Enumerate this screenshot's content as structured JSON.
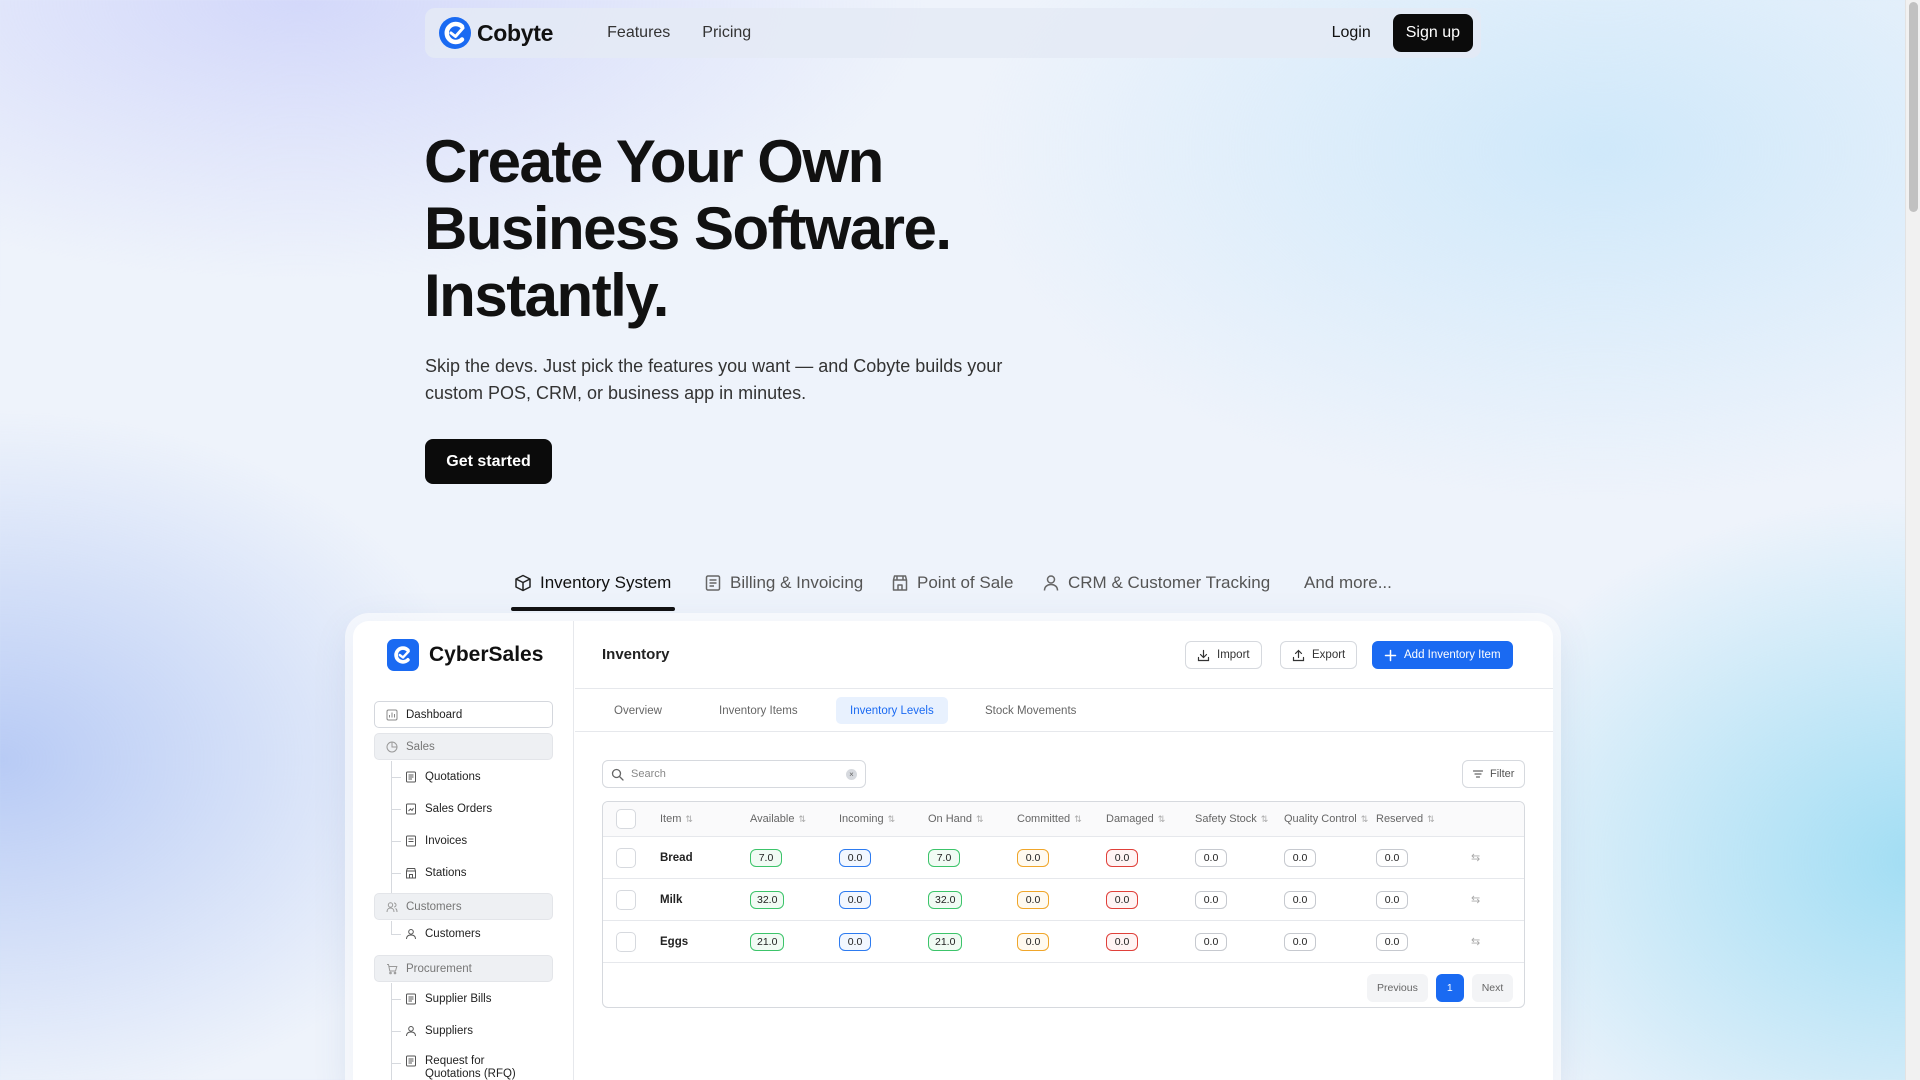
{
  "nav": {
    "brand": "Cobyte",
    "links": [
      "Features",
      "Pricing"
    ],
    "login": "Login",
    "signup": "Sign up"
  },
  "hero": {
    "title_lines": [
      "Create Your Own",
      "Business Software.",
      "Instantly."
    ],
    "subtitle": "Skip the devs. Just pick the features you want — and Cobyte builds your custom POS, CRM, or business app in minutes.",
    "cta": "Get started"
  },
  "feature_tabs": [
    {
      "label": "Inventory System",
      "icon": "box-icon",
      "active": true
    },
    {
      "label": "Billing & Invoicing",
      "icon": "document-icon",
      "active": false
    },
    {
      "label": "Point of Sale",
      "icon": "store-icon",
      "active": false
    },
    {
      "label": "CRM & Customer Tracking",
      "icon": "user-icon",
      "active": false
    },
    {
      "label": "And more...",
      "icon": "",
      "active": false
    }
  ],
  "app": {
    "brand": "CyberSales",
    "accent": "#1a6af2",
    "sidebar": {
      "dashboard": "Dashboard",
      "sales": "Sales",
      "sales_items": [
        "Quotations",
        "Sales Orders",
        "Invoices",
        "Stations"
      ],
      "customers_group": "Customers",
      "customers_items": [
        "Customers"
      ],
      "procurement": "Procurement",
      "procurement_items": [
        "Supplier Bills",
        "Suppliers",
        "Request for Quotations (RFQ)"
      ]
    },
    "page_title": "Inventory",
    "header_buttons": {
      "import": "Import",
      "export": "Export",
      "add": "Add Inventory Item"
    },
    "tabs": [
      "Overview",
      "Inventory Items",
      "Inventory Levels",
      "Stock Movements"
    ],
    "active_tab": "Inventory Levels",
    "search_placeholder": "Search",
    "filter": "Filter",
    "table": {
      "columns": [
        "Item",
        "Available",
        "Incoming",
        "On Hand",
        "Committed",
        "Damaged",
        "Safety Stock",
        "Quality Control",
        "Reserved"
      ],
      "rows": [
        {
          "item": "Bread",
          "values": [
            "7.0",
            "0.0",
            "7.0",
            "0.0",
            "0.0",
            "0.0",
            "0.0",
            "0.0"
          ]
        },
        {
          "item": "Milk",
          "values": [
            "32.0",
            "0.0",
            "32.0",
            "0.0",
            "0.0",
            "0.0",
            "0.0",
            "0.0"
          ]
        },
        {
          "item": "Eggs",
          "values": [
            "21.0",
            "0.0",
            "21.0",
            "0.0",
            "0.0",
            "0.0",
            "0.0",
            "0.0"
          ]
        }
      ]
    },
    "pager": {
      "previous": "Previous",
      "page": "1",
      "next": "Next"
    }
  }
}
